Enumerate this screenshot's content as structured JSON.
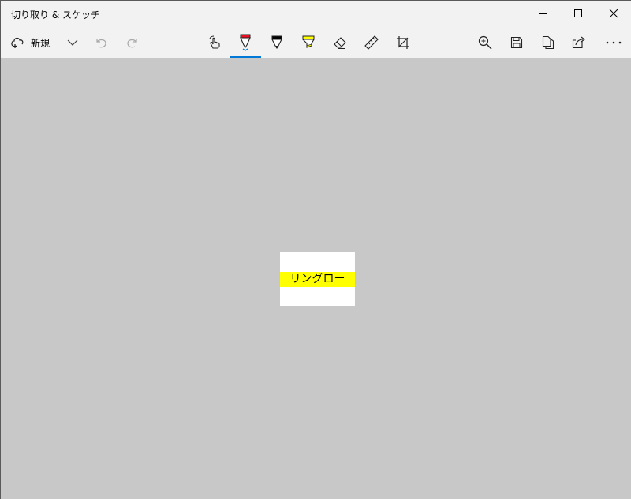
{
  "window": {
    "title": "切り取り & スケッチ"
  },
  "controls": {
    "minimize": "minimize-icon",
    "maximize": "maximize-icon",
    "close": "close-icon"
  },
  "toolbar": {
    "new_label": "新規",
    "active_tool": "ballpoint-pen",
    "accent_color": "#0078d7",
    "pen_colors": {
      "ballpoint": "#e81123",
      "pencil": "#000000",
      "highlighter": "#ffff00"
    }
  },
  "canvas": {
    "background": "#c8c8c8",
    "snip_text": "リングロー",
    "highlight_color": "#ffff00"
  }
}
